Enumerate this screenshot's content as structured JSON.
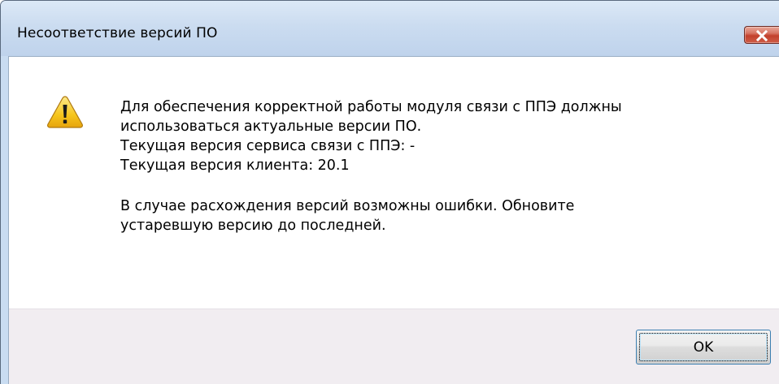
{
  "window": {
    "title": "Несоответствие версий ПО",
    "close_icon": "close-icon"
  },
  "dialog": {
    "icon": "warning-icon",
    "message_lines": [
      "Для обеспечения корректной работы модуля связи с ППЭ должны",
      "использоваться актуальные версии ПО.",
      "Текущая версия сервиса связи с ППЭ: -",
      "Текущая версия клиента: 20.1",
      "В случае расхождения версий возможны ошибки. Обновите",
      "устаревшую версию до последней."
    ],
    "ok_label": "OK"
  },
  "colors": {
    "titlebar": "#c9dcf1",
    "close_button": "#c2402c",
    "warning_yellow": "#f6c51c",
    "footer": "#f1edf1",
    "ok_border": "#3c7fb1"
  }
}
